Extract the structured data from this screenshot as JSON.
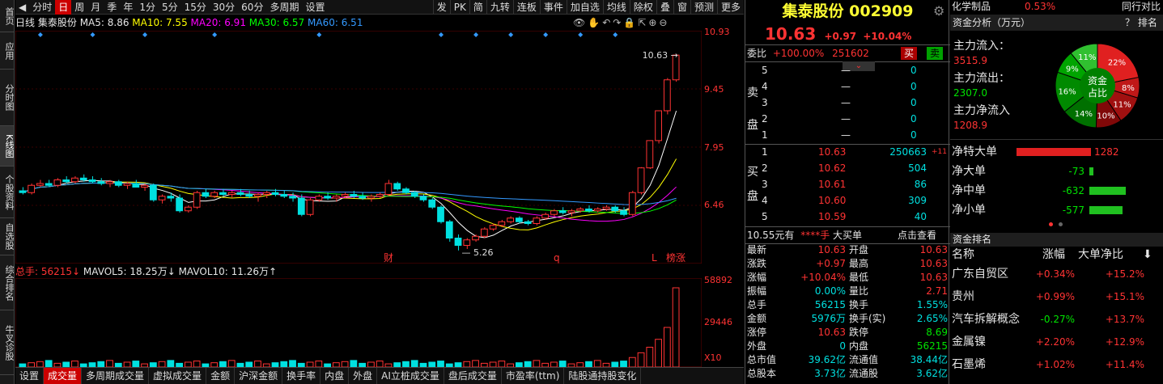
{
  "left_tabs": [
    "首页",
    "应用",
    "分时图",
    "K线图",
    "个股资料",
    "自选股",
    "综合排名",
    "牛叉诊股"
  ],
  "period_bar": {
    "items": [
      "分时",
      "日",
      "周",
      "月",
      "季",
      "年",
      "1分",
      "5分",
      "15分",
      "30分",
      "60分",
      "多周期",
      "设置"
    ],
    "selected": "日",
    "right_items": [
      "发",
      "PK",
      "简",
      "九转",
      "连板",
      "事件",
      "加自选",
      "均线",
      "除权",
      "叠",
      "窗",
      "预测",
      "更多"
    ]
  },
  "chart_info": {
    "period": "日线",
    "name": "集泰股份",
    "ma5": "MA5: 8.86",
    "ma10": "MA10: 7.55",
    "ma20": "MA20: 6.91",
    "ma30": "MA30: 6.57",
    "ma60": "MA60: 6.51",
    "icons": [
      "eye-icon",
      "hand-icon",
      "undo-icon",
      "redo-icon",
      "lock-icon",
      "cursor-icon",
      "zoom-in-icon",
      "zoom-out-icon"
    ]
  },
  "price_scale": [
    "10.93",
    "9.45",
    "7.95",
    "6.46"
  ],
  "price_annotations": {
    "high": "10.63",
    "low": "5.26",
    "markers": [
      "财",
      "q",
      "L",
      "榜涨"
    ]
  },
  "colors": {
    "up": "#ff3333",
    "down": "#00e0e0",
    "ma5": "#ffffff",
    "ma10": "#ffff00",
    "ma20": "#ff00ff",
    "ma30": "#00ff00",
    "ma60": "#3399ff"
  },
  "chart_data": {
    "type": "candlestick",
    "ylim": [
      4.9,
      11.3
    ],
    "candles": [
      [
        6.9,
        7.0,
        6.8,
        6.85
      ],
      [
        6.85,
        7.1,
        6.8,
        7.05
      ],
      [
        7.05,
        7.2,
        7.0,
        7.1
      ],
      [
        7.1,
        7.2,
        7.0,
        7.05
      ],
      [
        7.05,
        7.25,
        7.0,
        7.2
      ],
      [
        7.2,
        7.3,
        7.1,
        7.15
      ],
      [
        7.15,
        7.3,
        7.1,
        7.25
      ],
      [
        7.25,
        7.35,
        7.15,
        7.2
      ],
      [
        7.2,
        7.3,
        7.1,
        7.15
      ],
      [
        7.15,
        7.25,
        7.05,
        7.1
      ],
      [
        7.1,
        7.2,
        7.0,
        7.15
      ],
      [
        7.15,
        7.2,
        7.0,
        7.05
      ],
      [
        7.05,
        7.15,
        6.95,
        7.1
      ],
      [
        7.1,
        7.2,
        7.0,
        7.0
      ],
      [
        7.0,
        7.1,
        6.9,
        7.05
      ],
      [
        7.05,
        7.1,
        6.6,
        6.65
      ],
      [
        6.65,
        6.8,
        6.55,
        6.75
      ],
      [
        6.75,
        6.85,
        6.6,
        6.7
      ],
      [
        6.7,
        6.8,
        6.3,
        6.35
      ],
      [
        6.35,
        6.5,
        6.3,
        6.45
      ],
      [
        6.45,
        6.9,
        6.4,
        6.85
      ],
      [
        6.85,
        6.95,
        6.7,
        6.75
      ],
      [
        6.75,
        6.9,
        6.7,
        6.85
      ],
      [
        6.85,
        6.95,
        6.75,
        6.8
      ],
      [
        6.8,
        6.9,
        6.7,
        6.85
      ],
      [
        6.85,
        6.95,
        6.75,
        6.8
      ],
      [
        6.8,
        6.9,
        6.7,
        6.75
      ],
      [
        6.75,
        6.85,
        6.6,
        6.8
      ],
      [
        6.8,
        6.9,
        6.7,
        6.85
      ],
      [
        6.85,
        6.95,
        6.75,
        6.8
      ],
      [
        6.8,
        6.9,
        6.7,
        6.75
      ],
      [
        6.75,
        6.85,
        6.6,
        6.7
      ],
      [
        6.7,
        6.8,
        6.2,
        6.25
      ],
      [
        6.25,
        6.7,
        6.2,
        6.65
      ],
      [
        6.65,
        6.8,
        6.6,
        6.75
      ],
      [
        6.75,
        6.85,
        6.65,
        6.7
      ],
      [
        6.7,
        6.8,
        6.6,
        6.75
      ],
      [
        6.75,
        6.85,
        6.7,
        6.8
      ],
      [
        6.8,
        6.9,
        6.7,
        6.75
      ],
      [
        6.75,
        6.85,
        6.65,
        6.7
      ],
      [
        6.7,
        6.8,
        6.6,
        6.75
      ],
      [
        6.75,
        6.85,
        6.7,
        6.8
      ],
      [
        6.8,
        7.2,
        6.75,
        7.1
      ],
      [
        7.1,
        7.15,
        6.9,
        6.95
      ],
      [
        6.95,
        7.0,
        6.8,
        6.85
      ],
      [
        6.85,
        6.9,
        6.7,
        6.75
      ],
      [
        6.75,
        6.8,
        6.6,
        6.65
      ],
      [
        6.65,
        6.7,
        6.4,
        6.45
      ],
      [
        6.45,
        6.5,
        6.0,
        6.05
      ],
      [
        6.05,
        6.1,
        5.5,
        5.6
      ],
      [
        5.6,
        5.7,
        5.26,
        5.4
      ],
      [
        5.4,
        5.6,
        5.3,
        5.55
      ],
      [
        5.55,
        5.7,
        5.5,
        5.65
      ],
      [
        5.65,
        5.9,
        5.6,
        5.85
      ],
      [
        5.85,
        6.0,
        5.8,
        5.95
      ],
      [
        5.95,
        6.1,
        5.9,
        6.05
      ],
      [
        6.05,
        6.2,
        6.0,
        6.15
      ],
      [
        6.15,
        6.2,
        6.0,
        6.05
      ],
      [
        6.05,
        6.1,
        5.95,
        6.0
      ],
      [
        6.0,
        6.2,
        5.95,
        6.15
      ],
      [
        6.15,
        6.3,
        6.1,
        6.25
      ],
      [
        6.25,
        6.4,
        6.2,
        6.35
      ],
      [
        6.35,
        6.45,
        6.25,
        6.3
      ],
      [
        6.3,
        6.4,
        6.2,
        6.35
      ],
      [
        6.35,
        6.45,
        6.3,
        6.4
      ],
      [
        6.4,
        6.5,
        6.3,
        6.35
      ],
      [
        6.35,
        6.45,
        6.3,
        6.4
      ],
      [
        6.4,
        6.5,
        6.35,
        6.45
      ],
      [
        6.45,
        6.5,
        6.3,
        6.35
      ],
      [
        6.35,
        6.45,
        6.2,
        6.25
      ],
      [
        6.25,
        6.9,
        6.2,
        6.85
      ],
      [
        6.85,
        7.55,
        6.8,
        7.53
      ],
      [
        7.53,
        8.29,
        7.5,
        8.28
      ],
      [
        8.28,
        9.11,
        8.2,
        9.1
      ],
      [
        9.1,
        10.0,
        9.0,
        9.95
      ],
      [
        9.95,
        10.63,
        9.9,
        10.63
      ]
    ],
    "volume_scale": [
      "58892",
      "29446",
      "X10"
    ]
  },
  "vol_info": {
    "total": "总手: 56215↓",
    "mavol5": "MAVOL5: 18.25万↓",
    "mavol10": "MAVOL10: 11.26万↑"
  },
  "bottom_tabs": [
    "设置",
    "成交量",
    "多周期成交量",
    "虚拟成交量",
    "金额",
    "沪深金额",
    "换手率",
    "内盘",
    "外盘",
    "AI立桩成交量",
    "盘后成交量",
    "市盈率(ttm)",
    "陆股通持股变化"
  ],
  "bottom_selected": "成交量",
  "quote": {
    "name": "集泰股份",
    "code": "002909",
    "price": "10.63",
    "change": "+0.97",
    "change_pct": "+10.04%",
    "weibi_label": "委比",
    "weibi": "+100.00%",
    "weicha": "251602",
    "buy_btn": "买",
    "sell_btn": "卖",
    "sell_label": "卖盘",
    "buy_label": "买盘",
    "asks": [
      {
        "lvl": "5",
        "price": "—",
        "vol": "0"
      },
      {
        "lvl": "4",
        "price": "—",
        "vol": "0"
      },
      {
        "lvl": "3",
        "price": "—",
        "vol": "0"
      },
      {
        "lvl": "2",
        "price": "—",
        "vol": "0"
      },
      {
        "lvl": "1",
        "price": "—",
        "vol": "0"
      }
    ],
    "bids": [
      {
        "lvl": "1",
        "price": "10.63",
        "vol": "250663",
        "delta": "+11"
      },
      {
        "lvl": "2",
        "price": "10.62",
        "vol": "504",
        "delta": ""
      },
      {
        "lvl": "3",
        "price": "10.61",
        "vol": "86",
        "delta": ""
      },
      {
        "lvl": "4",
        "price": "10.60",
        "vol": "309",
        "delta": ""
      },
      {
        "lvl": "5",
        "price": "10.59",
        "vol": "40",
        "delta": ""
      }
    ],
    "bigorder": {
      "price_text": "10.55元有",
      "stars": "****手",
      "label": "大买单",
      "action": "点击查看"
    },
    "stats": [
      {
        "l1": "最新",
        "v1": "10.63",
        "l2": "开盘",
        "v2": "10.63"
      },
      {
        "l1": "涨跌",
        "v1": "+0.97",
        "l2": "最高",
        "v2": "10.63"
      },
      {
        "l1": "涨幅",
        "v1": "+10.04%",
        "l2": "最低",
        "v2": "10.63"
      },
      {
        "l1": "振幅",
        "v1": "0.00%",
        "l2": "量比",
        "v2": "2.71"
      },
      {
        "l1": "总手",
        "v1": "56215",
        "l2": "换手",
        "v2": "1.55%"
      },
      {
        "l1": "金额",
        "v1": "5976万",
        "l2": "换手(实)",
        "v2": "2.65%"
      },
      {
        "l1": "涨停",
        "v1": "10.63",
        "l2": "跌停",
        "v2": "8.69"
      },
      {
        "l1": "外盘",
        "v1": "0",
        "l2": "内盘",
        "v2": "56215"
      },
      {
        "l1": "总市值",
        "v1": "39.62亿",
        "l2": "流通值",
        "v2": "38.44亿"
      },
      {
        "l1": "总股本",
        "v1": "3.73亿",
        "l2": "流通股",
        "v2": "3.62亿"
      }
    ]
  },
  "right": {
    "top_row": {
      "sector": "化学制品",
      "pct": "0.53%",
      "link": "同行对比"
    },
    "fund_title": "资金分析（万元）",
    "fund_help": "？ 排名",
    "inflow_label": "主力流入：",
    "inflow": "3515.9",
    "outflow_label": "主力流出：",
    "outflow": "2307.0",
    "net_label": "主力净流入",
    "net": "1208.9",
    "pie_center": [
      "资金",
      "占比"
    ],
    "pie": [
      {
        "label": "22%",
        "value": 22,
        "color": "#e02020"
      },
      {
        "label": "8%",
        "value": 8,
        "color": "#c01818"
      },
      {
        "label": "11%",
        "value": 11,
        "color": "#a01010"
      },
      {
        "label": "10%",
        "value": 10,
        "color": "#800808"
      },
      {
        "label": "14%",
        "value": 14,
        "color": "#007000"
      },
      {
        "label": "16%",
        "value": 16,
        "color": "#008a00"
      },
      {
        "label": "9%",
        "value": 9,
        "color": "#00a400"
      },
      {
        "label": "11%",
        "value": 11,
        "color": "#30c030"
      }
    ],
    "flows": [
      {
        "label": "净特大单",
        "value": "1282",
        "num": 1282,
        "color": "#e02020"
      },
      {
        "label": "净大单",
        "value": "-73",
        "num": -73,
        "color": "#20c020"
      },
      {
        "label": "净中单",
        "value": "-632",
        "num": -632,
        "color": "#20c020"
      },
      {
        "label": "净小单",
        "value": "-577",
        "num": -577,
        "color": "#20c020"
      }
    ],
    "rank_title": "资金排名",
    "rank_headers": [
      "名称",
      "涨幅",
      "大单净比"
    ],
    "rank": [
      {
        "name": "广东自贸区",
        "pct": "+0.34%",
        "net": "+15.2%"
      },
      {
        "name": "贵州",
        "pct": "+0.99%",
        "net": "+15.1%"
      },
      {
        "name": "汽车拆解概念",
        "pct": "-0.27%",
        "net": "+13.7%"
      },
      {
        "name": "金属镍",
        "pct": "+2.20%",
        "net": "+12.9%"
      },
      {
        "name": "石墨烯",
        "pct": "+1.02%",
        "net": "+11.4%"
      }
    ]
  }
}
